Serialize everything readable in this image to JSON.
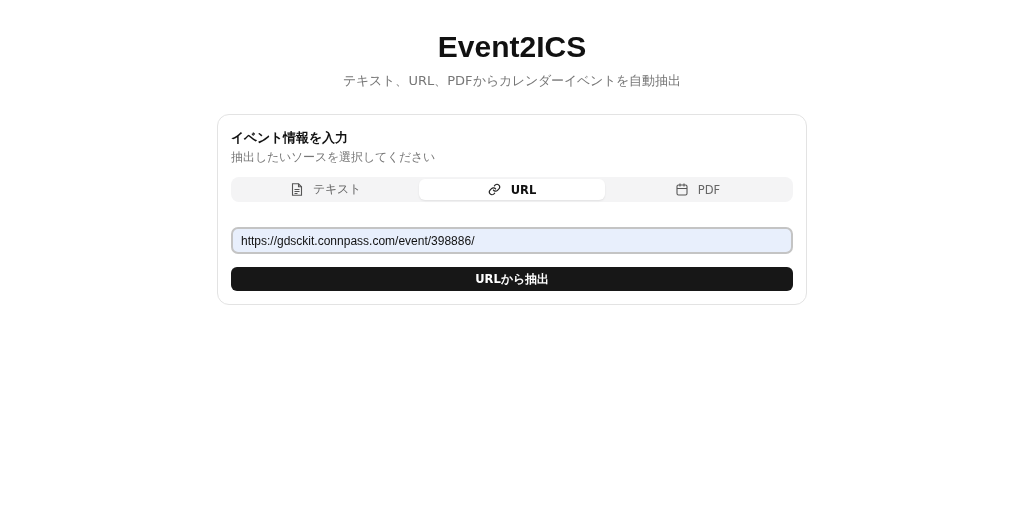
{
  "header": {
    "title": "Event2ICS",
    "subtitle": "テキスト、URL、PDFからカレンダーイベントを自動抽出"
  },
  "card": {
    "title": "イベント情報を入力",
    "description": "抽出したいソースを選択してください",
    "tabs": [
      {
        "label": "テキスト",
        "kind": "document",
        "selected": false
      },
      {
        "label": "URL",
        "kind": "link",
        "selected": true
      },
      {
        "label": "PDF",
        "kind": "calendar",
        "selected": false
      }
    ],
    "url_field": {
      "value": "https://gdsckit.connpass.com/event/398886/",
      "focused": true
    },
    "submit_button": "URLから抽出"
  }
}
